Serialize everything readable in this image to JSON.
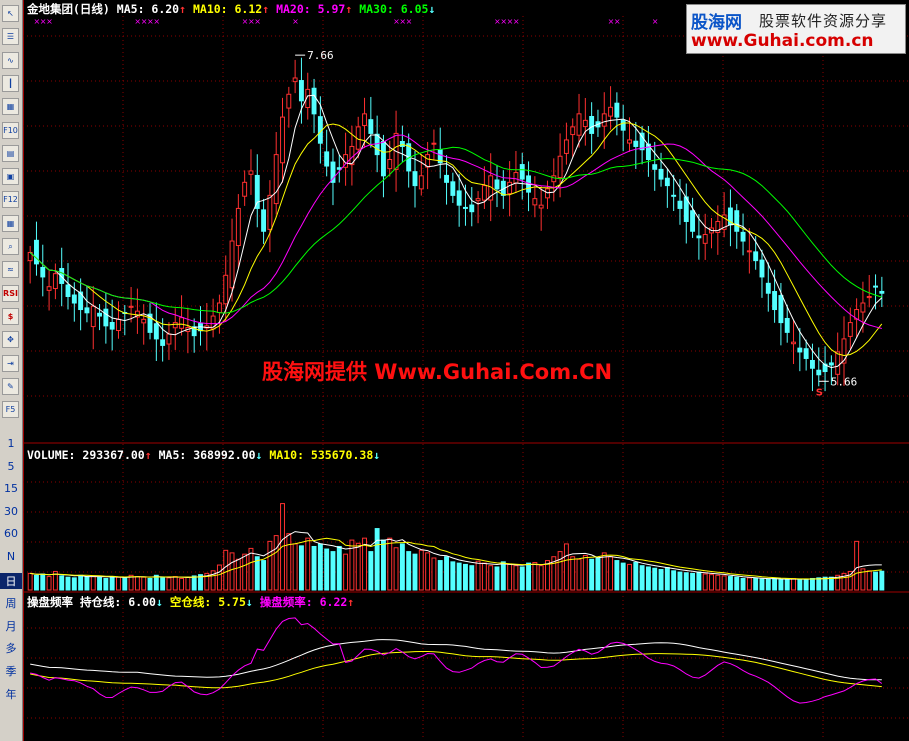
{
  "toolbar": {
    "buttons": [
      {
        "label": "",
        "icon": "cursor-icon"
      },
      {
        "label": "",
        "icon": "list-icon"
      },
      {
        "label": "",
        "icon": "line-chart-icon"
      },
      {
        "label": "",
        "icon": "candlestick-icon"
      },
      {
        "label": "",
        "icon": "multi-window-icon"
      },
      {
        "label": "F10",
        "icon": "f10-icon"
      },
      {
        "label": "",
        "icon": "report-icon"
      },
      {
        "label": "",
        "icon": "notebook-icon"
      },
      {
        "label": "F12",
        "icon": "f12-icon"
      },
      {
        "label": "",
        "icon": "grid-icon"
      },
      {
        "label": "",
        "icon": "search-icon"
      },
      {
        "label": "",
        "icon": "wave-icon"
      },
      {
        "label": "RSI",
        "icon": "rsi-icon"
      },
      {
        "label": "$",
        "icon": "dollar-icon"
      },
      {
        "label": "",
        "icon": "move-icon"
      },
      {
        "label": "",
        "icon": "export-icon"
      },
      {
        "label": "",
        "icon": "pencil-icon"
      },
      {
        "label": "F5",
        "icon": "f5-icon"
      }
    ],
    "periods": [
      "1",
      "5",
      "15",
      "30",
      "60",
      "N",
      "日",
      "周",
      "月",
      "多",
      "季",
      "年"
    ],
    "selected_period": "日"
  },
  "logo": {
    "line1": "股海网",
    "line2": "股票软件资源分享",
    "line3": "www.Guhai.com.cn"
  },
  "watermark": "股海网提供 Www.Guhai.Com.CN",
  "panels": {
    "price": {
      "stock_name": "金地集团",
      "period_label": "(日线)",
      "indicators": [
        {
          "label": "MA5:",
          "value": "6.20",
          "arrow": "↑",
          "color": "#ffffff"
        },
        {
          "label": "MA10:",
          "value": "6.12",
          "arrow": "↑",
          "color": "#ffff00"
        },
        {
          "label": "MA20:",
          "value": "5.97",
          "arrow": "↑",
          "color": "#ff00ff"
        },
        {
          "label": "MA30:",
          "value": "6.05",
          "arrow": "↓",
          "color": "#00ff00"
        }
      ],
      "high_label": "7.66",
      "low_label": "5.66",
      "low_marker": "S"
    },
    "volume": {
      "label": "VOLUME:",
      "value": "293367.00",
      "arrow": "↑",
      "indicators": [
        {
          "label": "MA5:",
          "value": "368992.00",
          "arrow": "↓",
          "color": "#ffffff"
        },
        {
          "label": "MA10:",
          "value": "535670.38",
          "arrow": "↓",
          "color": "#ffff00"
        }
      ]
    },
    "oscillator": {
      "name": "操盘频率",
      "indicators": [
        {
          "label": "持仓线:",
          "value": "6.00",
          "arrow": "↓",
          "color": "#ffffff"
        },
        {
          "label": "空仓线:",
          "value": "5.75",
          "arrow": "↓",
          "color": "#ffff00"
        },
        {
          "label": "操盘频率:",
          "value": "6.22",
          "arrow": "↑",
          "color": "#ff00ff"
        }
      ]
    }
  },
  "colors": {
    "up": "#ff3030",
    "down": "#54ffff",
    "grid": "#8b0000",
    "ma5": "#ffffff",
    "ma10": "#ffff00",
    "ma20": "#ff00ff",
    "ma30": "#00ff00"
  },
  "chart_data": {
    "type": "candlestick",
    "title": "金地集团 (日线)",
    "price_range": [
      5.3,
      7.9
    ],
    "high": 7.66,
    "low": 5.66,
    "close": [
      6.45,
      6.38,
      6.3,
      6.24,
      6.32,
      6.26,
      6.18,
      6.14,
      6.1,
      6.08,
      6.12,
      6.06,
      6.0,
      5.98,
      6.04,
      6.08,
      6.12,
      6.09,
      6.04,
      5.96,
      5.92,
      5.88,
      5.95,
      6.02,
      6.05,
      5.99,
      5.94,
      5.97,
      6.0,
      6.06,
      6.14,
      6.31,
      6.52,
      6.72,
      6.88,
      6.95,
      6.72,
      6.58,
      6.8,
      7.05,
      7.28,
      7.42,
      7.52,
      7.38,
      7.45,
      7.3,
      7.12,
      6.98,
      6.88,
      6.96,
      7.05,
      7.1,
      7.22,
      7.3,
      7.18,
      7.05,
      6.92,
      7.02,
      7.18,
      7.1,
      6.95,
      6.86,
      6.92,
      7.05,
      7.12,
      7.0,
      6.88,
      6.8,
      6.74,
      6.72,
      6.7,
      6.78,
      6.86,
      6.92,
      6.84,
      6.8,
      6.88,
      6.94,
      6.9,
      6.82,
      6.78,
      6.74,
      6.84,
      6.92,
      7.04,
      7.14,
      7.22,
      7.3,
      7.26,
      7.18,
      7.22,
      7.3,
      7.34,
      7.28,
      7.2,
      7.14,
      7.1,
      7.08,
      7.02,
      6.96,
      6.9,
      6.86,
      6.8,
      6.72,
      6.64,
      6.58,
      6.54,
      6.56,
      6.6,
      6.64,
      6.68,
      6.62,
      6.58,
      6.52,
      6.46,
      6.4,
      6.3,
      6.2,
      6.1,
      6.02,
      5.96,
      5.9,
      5.84,
      5.8,
      5.74,
      5.7,
      5.72,
      5.76,
      5.84,
      5.92,
      6.02,
      6.1,
      6.14,
      6.18,
      6.24,
      6.2
    ],
    "ma_labels": [
      "MA5",
      "MA10",
      "MA20",
      "MA30"
    ],
    "volume_max": 2000000,
    "volume": [
      260000,
      230000,
      250000,
      210000,
      290000,
      220000,
      200000,
      190000,
      230000,
      210000,
      220000,
      200000,
      180000,
      210000,
      200000,
      190000,
      230000,
      210000,
      200000,
      180000,
      230000,
      200000,
      190000,
      210000,
      180000,
      200000,
      220000,
      240000,
      260000,
      300000,
      390000,
      620000,
      580000,
      480000,
      560000,
      650000,
      520000,
      460000,
      760000,
      850000,
      1350000,
      880000,
      720000,
      690000,
      810000,
      680000,
      720000,
      640000,
      600000,
      680000,
      560000,
      780000,
      730000,
      810000,
      600000,
      960000,
      780000,
      810000,
      660000,
      720000,
      600000,
      560000,
      620000,
      580000,
      500000,
      460000,
      520000,
      440000,
      420000,
      400000,
      380000,
      450000,
      420000,
      380000,
      360000,
      440000,
      400000,
      380000,
      360000,
      420000,
      430000,
      380000,
      460000,
      520000,
      600000,
      720000,
      520000,
      480000,
      540000,
      480000,
      500000,
      580000,
      520000,
      460000,
      420000,
      400000,
      430000,
      380000,
      360000,
      340000,
      320000,
      350000,
      300000,
      280000,
      270000,
      260000,
      280000,
      250000,
      240000,
      230000,
      220000,
      210000,
      200000,
      180000,
      190000,
      180000,
      170000,
      170000,
      180000,
      160000,
      170000,
      180000,
      160000,
      170000,
      180000,
      190000,
      200000,
      200000,
      230000,
      260000,
      290000,
      760000,
      330000,
      300000,
      280000,
      293367
    ],
    "oscillator_range": [
      4.5,
      8.5
    ]
  }
}
